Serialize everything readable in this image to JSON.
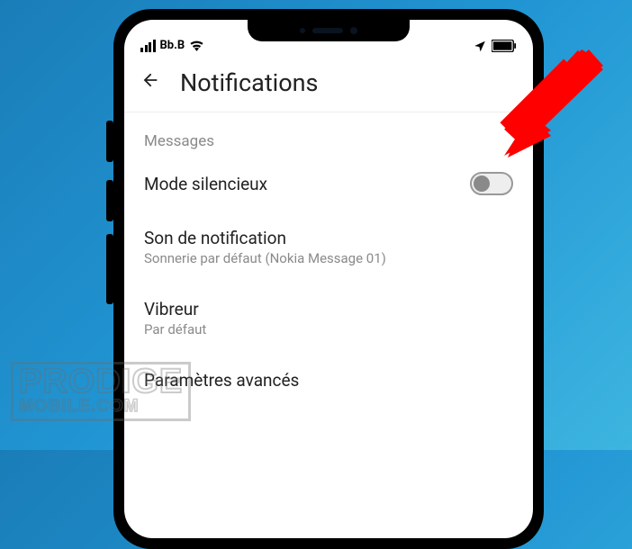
{
  "statusbar": {
    "carrier": "Bb.B"
  },
  "header": {
    "title": "Notifications"
  },
  "section": {
    "label": "Messages"
  },
  "settings": {
    "silent": {
      "title": "Mode silencieux",
      "enabled": false
    },
    "sound": {
      "title": "Son de notification",
      "subtitle": "Sonnerie par défaut (Nokia Message 01)"
    },
    "vibrate": {
      "title": "Vibreur",
      "subtitle": "Par défaut"
    },
    "advanced": {
      "title": "Paramètres avancés"
    }
  },
  "watermark": {
    "line1": "PRODIGE",
    "line2": "MOBILE.COM"
  }
}
